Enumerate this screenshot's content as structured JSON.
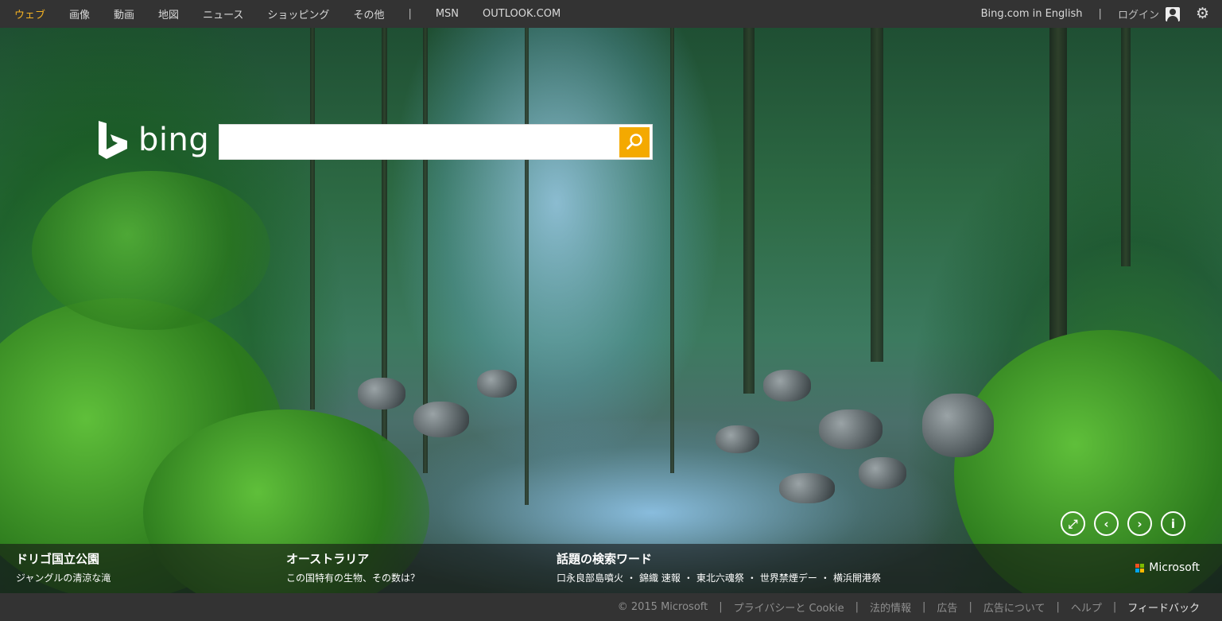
{
  "nav": {
    "left": [
      "ウェブ",
      "画像",
      "動画",
      "地図",
      "ニュース",
      "ショッピング",
      "その他"
    ],
    "separator": "|",
    "extra": [
      "MSN",
      "OUTLOOK.COM"
    ],
    "english": "Bing.com in English",
    "login": "ログイン",
    "active_color": "#f4b223",
    "settings_icon": "gear-icon"
  },
  "logo": {
    "text": "bing"
  },
  "search": {
    "placeholder": "",
    "value": "",
    "button_icon": "magnifier-icon",
    "button_color": "#f4a900"
  },
  "controls": [
    {
      "name": "fullscreen-icon",
      "glyph": "⤢"
    },
    {
      "name": "previous-icon",
      "glyph": "‹"
    },
    {
      "name": "next-icon",
      "glyph": "›"
    },
    {
      "name": "info-icon",
      "glyph": "i"
    }
  ],
  "captions": [
    {
      "title": "ドリゴ国立公園",
      "subtitle": "ジャングルの清涼な滝"
    },
    {
      "title": "オーストラリア",
      "subtitle": "この国特有の生物、その数は？"
    }
  ],
  "trending": {
    "title": "話題の検索ワード",
    "items": [
      "口永良部島噴火",
      "錦織 速報",
      "東北六魂祭",
      "世界禁煙デー",
      "横浜開港祭"
    ],
    "separator": "・"
  },
  "microsoft": {
    "label": "Microsoft",
    "colors": [
      "#f25022",
      "#7fba00",
      "#00a4ef",
      "#ffb900"
    ]
  },
  "footer": {
    "copyright": "© 2015 Microsoft",
    "links": [
      "プライバシーと Cookie",
      "法的情報",
      "広告",
      "広告について",
      "ヘルプ"
    ],
    "feedback": "フィードバック",
    "separator": "|"
  }
}
